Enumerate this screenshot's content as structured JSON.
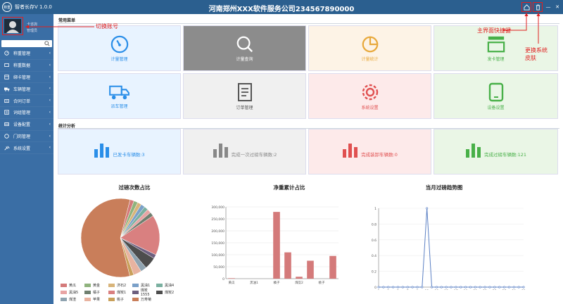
{
  "titlebar": {
    "logo": "称重",
    "app_name": "智者长存V 1.0.0",
    "company": "河南郑州XXX软件服务公司234567890000",
    "home_icon": "home-icon",
    "skin_icon": "trash-skin-icon",
    "minimize": "—",
    "close": "✕"
  },
  "user": {
    "name": "卡咨詢",
    "role": "管理员"
  },
  "search": {
    "placeholder": ""
  },
  "menu": [
    {
      "label": "称重管理",
      "icon": "gauge-icon",
      "color": "#ffffff"
    },
    {
      "label": "称重数据",
      "icon": "db-icon",
      "color": "#ffffff"
    },
    {
      "label": "绑卡管理",
      "icon": "card-icon",
      "color": "#ffffff"
    },
    {
      "label": "车辆管理",
      "icon": "truck-icon",
      "color": "#ffffff"
    },
    {
      "label": "合同订单",
      "icon": "contract-icon",
      "color": "#ffffff"
    },
    {
      "label": "词组管理",
      "icon": "list-icon",
      "color": "#ffffff"
    },
    {
      "label": "设备配置",
      "icon": "device-icon",
      "color": "#ffffff"
    },
    {
      "label": "门岗管理",
      "icon": "gate-icon",
      "color": "#ffffff"
    },
    {
      "label": "系统设置",
      "icon": "tools-icon",
      "color": "#ffffff"
    }
  ],
  "sections": {
    "common": "常用菜单",
    "stats": "统计分析"
  },
  "tiles": [
    {
      "label": "计量管理",
      "icon": "gauge-icon",
      "color": "#2a8ee8",
      "bg": "#e8f3ff"
    },
    {
      "label": "计量查询",
      "icon": "search-icon",
      "color": "#ffffff",
      "bg": "#8c8c8c"
    },
    {
      "label": "计量统计",
      "icon": "pie-icon",
      "color": "#e8a93c",
      "bg": "#fdf3e6"
    },
    {
      "label": "发卡管理",
      "icon": "card-tray-icon",
      "color": "#48b048",
      "bg": "#eaf6e6"
    },
    {
      "label": "派车管理",
      "icon": "truck-icon",
      "color": "#2a8ee8",
      "bg": "#e8f3ff"
    },
    {
      "label": "订单管理",
      "icon": "document-icon",
      "color": "#555555",
      "bg": "#f0f0f0"
    },
    {
      "label": "系统设置",
      "icon": "gear-icon",
      "color": "#e05050",
      "bg": "#fdeaea"
    },
    {
      "label": "设备设置",
      "icon": "tablet-icon",
      "color": "#48b048",
      "bg": "#eaf6e6"
    }
  ],
  "stats": [
    {
      "label": "已发卡车辆数:3",
      "icon": "bar-icon",
      "color": "#2a8ee8",
      "bg": "#e8f3ff"
    },
    {
      "label": "完成一次过磅车辆数:2",
      "icon": "bar-icon",
      "color": "#888888",
      "bg": "#f0f0f0"
    },
    {
      "label": "完成装卸车辆数:0",
      "icon": "bar-icon",
      "color": "#e05050",
      "bg": "#fdeaea"
    },
    {
      "label": "完成过磅车辆数:121",
      "icon": "bar-icon",
      "color": "#48b048",
      "bg": "#eaf6e6"
    }
  ],
  "annotations": {
    "switch_account": "切换账号",
    "home_shortcut": "主界面快捷键",
    "change_skin": "更换系统皮肤"
  },
  "chart_data": [
    {
      "type": "pie",
      "title": "过磅次数占比",
      "legend_position": "bottom",
      "slices": [
        {
          "name": "黄瓜",
          "value": 2,
          "color": "#d47a7a"
        },
        {
          "name": "黄金",
          "value": 2,
          "color": "#8fb37d"
        },
        {
          "name": "济石2",
          "value": 2,
          "color": "#d8b47a"
        },
        {
          "name": "黑油1",
          "value": 2,
          "color": "#7aa0c8"
        },
        {
          "name": "黑油4",
          "value": 2,
          "color": "#7ab0a0"
        },
        {
          "name": "黑油5",
          "value": 2,
          "color": "#e8a4a4"
        },
        {
          "name": "橘子",
          "value": 2,
          "color": "#6f7f6f"
        },
        {
          "name": "煤炭1",
          "value": 20,
          "color": "#d98080"
        },
        {
          "name": "煤炭1555",
          "value": 2,
          "color": "#6d5f7f"
        },
        {
          "name": "煤炭2",
          "value": 6,
          "color": "#4d4d4d"
        },
        {
          "name": "煤渣",
          "value": 3,
          "color": "#8fa3b0"
        },
        {
          "name": "苹果",
          "value": 4,
          "color": "#e8b3a0"
        },
        {
          "name": "桃子",
          "value": 2,
          "color": "#c9a05a"
        },
        {
          "name": "万寿菊",
          "value": 70,
          "color": "#c97e5a"
        }
      ]
    },
    {
      "type": "bar",
      "title": "净重累计占比",
      "categories": [
        "黄瓜",
        "黑油1",
        "橘子",
        "煤炭2",
        "桃子"
      ],
      "x": [
        "黄瓜",
        "",
        "黑油1",
        "",
        "橘子",
        "",
        "煤炭2",
        "",
        "桃子",
        ""
      ],
      "values": [
        2000,
        0,
        0,
        0,
        850000,
        110000,
        8000,
        75000,
        0,
        95000
      ],
      "ylim": [
        0,
        300000
      ],
      "yticks": [
        "0",
        "50,000",
        "100,000",
        "150,000",
        "200,000",
        "250,000",
        "300,000"
      ],
      "color": "#d47a7a",
      "grid": true
    },
    {
      "type": "line",
      "title": "当月过磅趋势图",
      "x": [
        1,
        2,
        3,
        4,
        5,
        6,
        7,
        8,
        9,
        10,
        11,
        12,
        13,
        14,
        15,
        16,
        17,
        18,
        19,
        20,
        21,
        22,
        23,
        24,
        25,
        26,
        27,
        28,
        29,
        30,
        31
      ],
      "xticks": [
        "1",
        "3",
        "5",
        "7",
        "9",
        "11",
        "13",
        "15",
        "17",
        "19",
        "21",
        "23",
        "25",
        "27",
        "29",
        "31"
      ],
      "values": [
        0,
        0,
        0,
        0,
        0,
        0,
        0,
        0,
        0,
        0,
        1,
        0,
        0,
        0,
        0,
        0,
        0,
        0,
        0,
        0,
        0,
        0,
        0,
        0,
        0,
        0,
        0,
        0,
        0,
        0,
        0
      ],
      "ylim": [
        0,
        1
      ],
      "yticks": [
        "0",
        "0.2",
        "0.4",
        "0.6",
        "0.8",
        "1"
      ],
      "color": "#5b80c4",
      "grid": true
    }
  ]
}
